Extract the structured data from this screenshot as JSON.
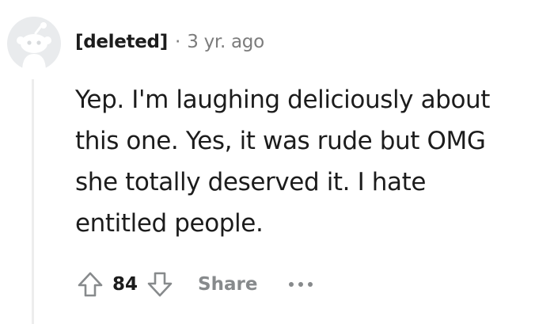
{
  "comment": {
    "author": "[deleted]",
    "separator": "·",
    "timestamp": "3 yr. ago",
    "body_lines": [
      "Yep. I'm laughing deliciously about",
      "this one. Yes, it was rude but OMG",
      "she totally deserved it. I hate",
      "entitled people."
    ],
    "score": "84",
    "share_label": "Share",
    "avatar_icon": "snoo-avatar-icon",
    "upvote_icon": "upvote-arrow-icon",
    "downvote_icon": "downvote-arrow-icon",
    "more_icon": "overflow-menu-icon"
  },
  "colors": {
    "text": "#1c1c1c",
    "muted": "#7c7c7c",
    "action_gray": "#878a8c",
    "avatar_gray": "#d7dadc",
    "thread_line": "#ededed"
  }
}
